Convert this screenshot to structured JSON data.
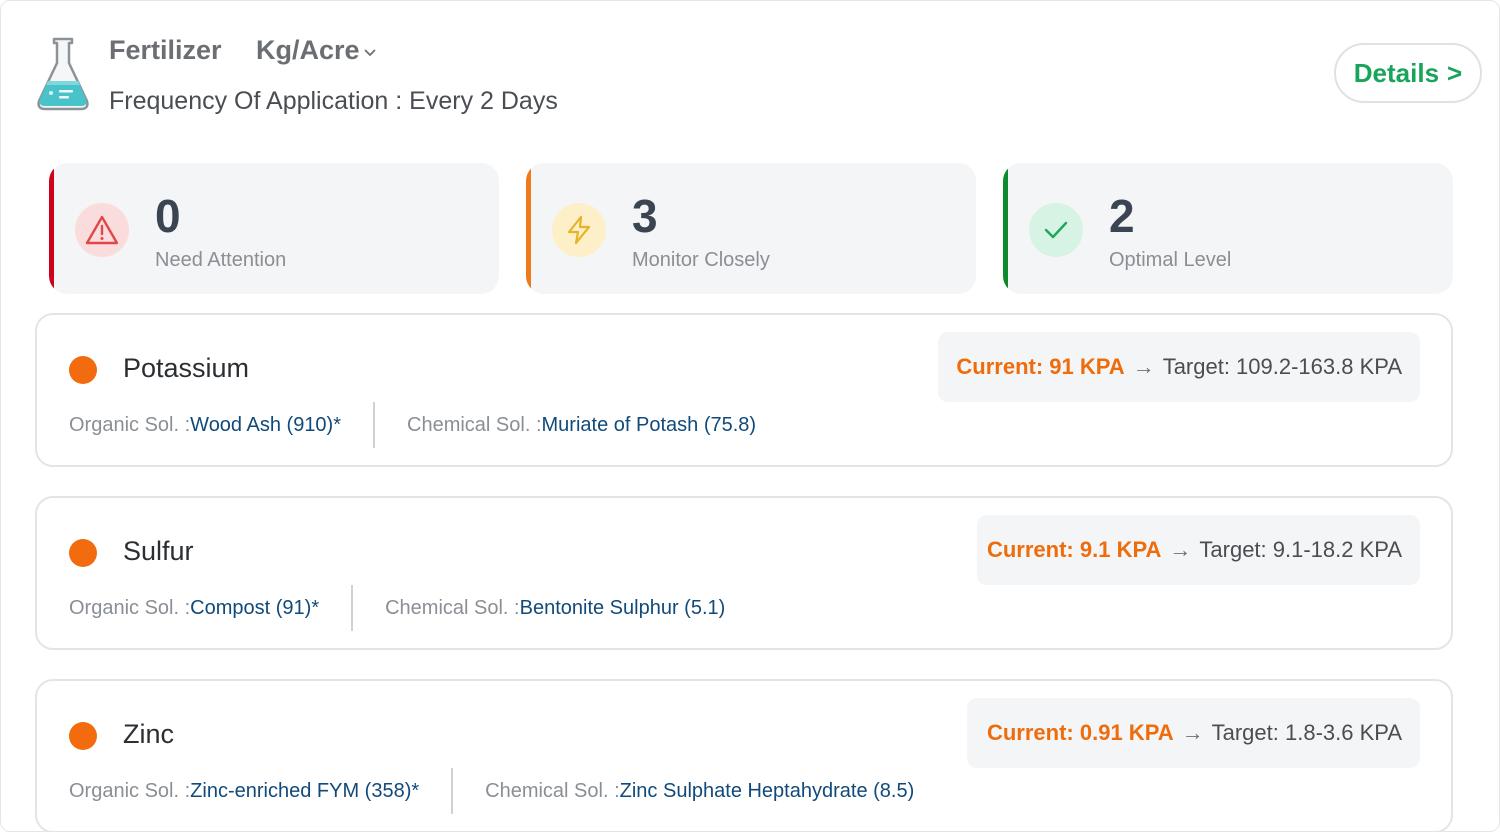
{
  "header": {
    "title": "Fertilizer",
    "unit": "Kg/Acre",
    "frequency_label": "Frequency Of Application : ",
    "frequency_value": "Every 2 Days",
    "details_label": "Details",
    "details_chevron": ">"
  },
  "stats": [
    {
      "count": "0",
      "label": "Need Attention",
      "accent": "#d0021b",
      "icon": "warning-triangle-icon"
    },
    {
      "count": "3",
      "label": "Monitor Closely",
      "accent": "#f07a1a",
      "icon": "lightning-icon"
    },
    {
      "count": "2",
      "label": "Optimal Level",
      "accent": "#0e8a2d",
      "icon": "checkmark-icon"
    }
  ],
  "nutrients": [
    {
      "name": "Potassium",
      "organic_label": "Organic Sol. : ",
      "organic_value": "Wood Ash (910)*",
      "chemical_label": "Chemical Sol. : ",
      "chemical_value": "Muriate of Potash (75.8)",
      "current": "Current: 91 KPA",
      "arrow": "→",
      "target": "Target: 109.2-163.8 KPA"
    },
    {
      "name": "Sulfur",
      "organic_label": "Organic Sol. : ",
      "organic_value": "Compost (91)*",
      "chemical_label": "Chemical Sol. : ",
      "chemical_value": "Bentonite Sulphur (5.1)",
      "current": "Current: 9.1 KPA",
      "arrow": "→",
      "target": "Target: 9.1-18.2 KPA"
    },
    {
      "name": "Zinc",
      "organic_label": "Organic Sol. : ",
      "organic_value": "Zinc-enriched FYM (358)*",
      "chemical_label": "Chemical Sol. : ",
      "chemical_value": "Zinc Sulphate Heptahydrate (8.5)",
      "current": "Current: 0.91 KPA",
      "arrow": "→",
      "target": "Target: 1.8-3.6 KPA"
    }
  ],
  "colors": {
    "status_orange": "#f26b0f",
    "link_blue": "#114a7a",
    "details_green": "#19a45b"
  }
}
